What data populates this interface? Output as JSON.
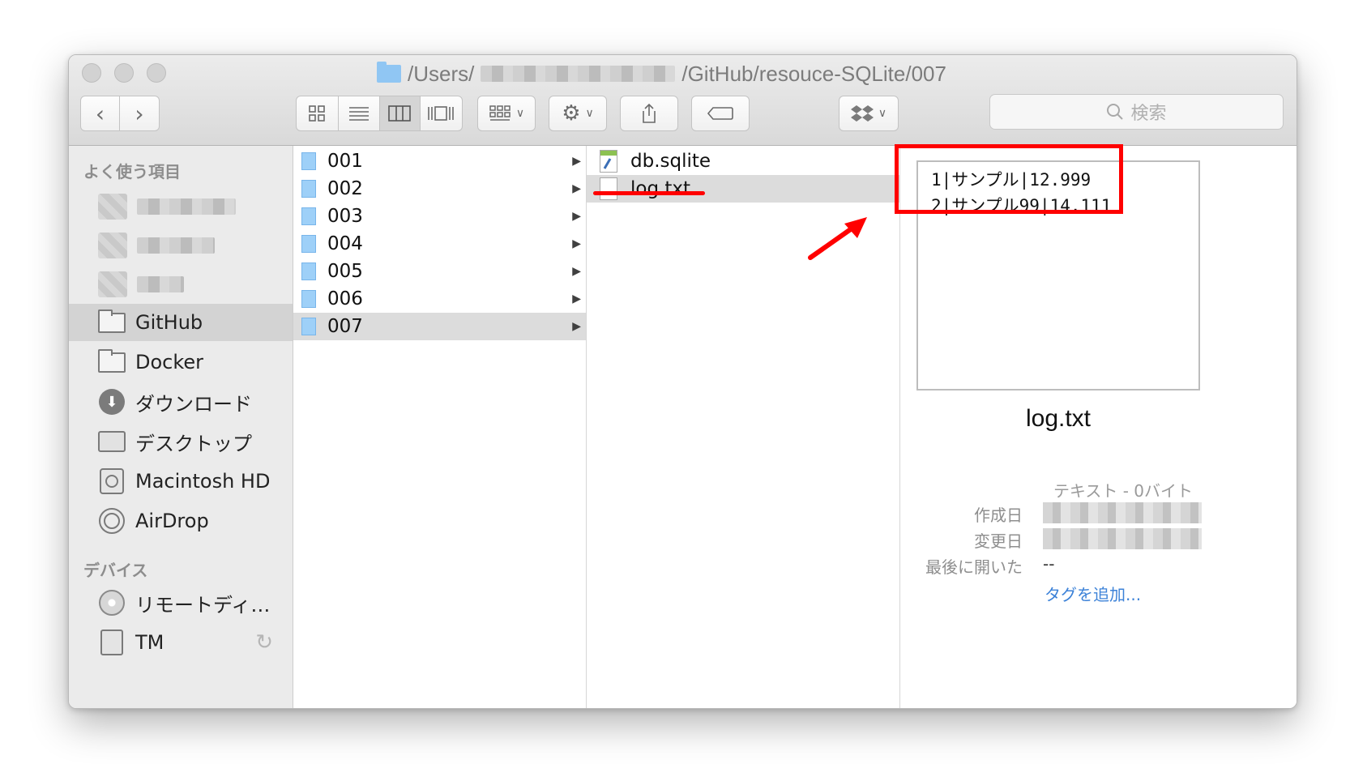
{
  "window": {
    "path_prefix": "/Users/",
    "path_suffix": "/GitHub/resouce-SQLite/007"
  },
  "toolbar": {
    "back_icon": "chevron-left-icon",
    "forward_icon": "chevron-right-icon",
    "search_placeholder": "検索"
  },
  "sidebar": {
    "favorites_header": "よく使う項目",
    "devices_header": "デバイス",
    "items": {
      "github": "GitHub",
      "docker": "Docker",
      "downloads": "ダウンロード",
      "desktop": "デスクトップ",
      "macintosh": "Macintosh HD",
      "airdrop": "AirDrop",
      "remote_disc": "リモートディ…",
      "tm": "TM"
    }
  },
  "column1": {
    "folders": [
      "001",
      "002",
      "003",
      "004",
      "005",
      "006",
      "007"
    ],
    "selected": "007"
  },
  "column2": {
    "files": [
      "db.sqlite",
      "log.txt"
    ],
    "selected": "log.txt"
  },
  "preview": {
    "line1": "1|サンプル|12.999",
    "line2": "2|サンプル99|14.111",
    "filename": "log.txt",
    "kind": "テキスト - 0バイト",
    "created_label": "作成日",
    "modified_label": "変更日",
    "last_opened_label": "最後に開いた",
    "last_opened_value": "--",
    "add_tag": "タグを追加..."
  },
  "colors": {
    "annotation": "#ff0000",
    "selection": "#dcdcdc",
    "folder": "#9ed0f8",
    "link": "#3c82d8"
  }
}
